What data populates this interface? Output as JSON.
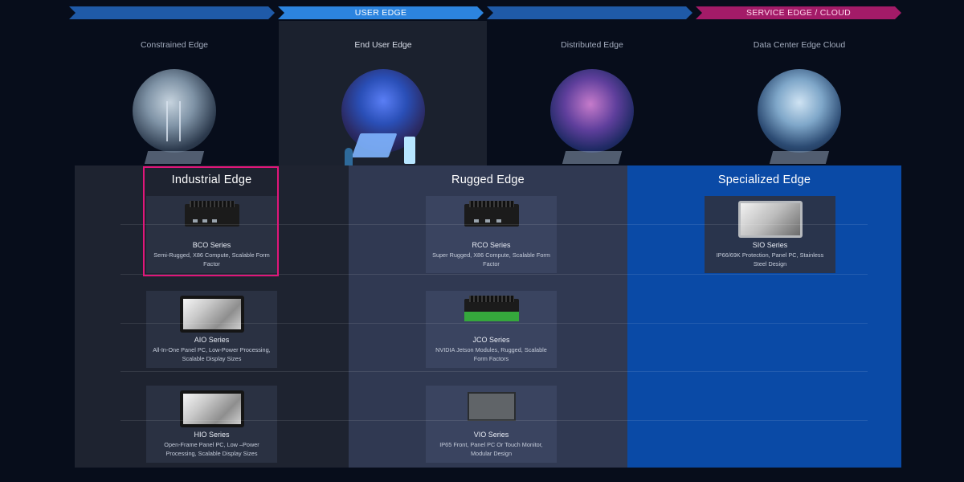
{
  "arrows": [
    "",
    "USER EDGE",
    "",
    "SERVICE EDGE / CLOUD"
  ],
  "tiers": [
    {
      "label": "Constrained Edge"
    },
    {
      "label": "End User Edge"
    },
    {
      "label": "Distributed Edge"
    },
    {
      "label": "Data Center Edge Cloud"
    }
  ],
  "categories": [
    {
      "title": "Industrial Edge"
    },
    {
      "title": "Rugged Edge"
    },
    {
      "title": "Specialized Edge"
    }
  ],
  "products": {
    "bco": {
      "name": "BCO Series",
      "desc": "Semi-Rugged, X86 Compute, Scalable Form Factor"
    },
    "aio": {
      "name": "AIO Series",
      "desc": "All-In-One Panel PC, Low-Power Processing, Scalable Display Sizes"
    },
    "hio": {
      "name": "HIO Series",
      "desc": "Open-Frame Panel PC, Low –Power Processing, Scalable Display Sizes"
    },
    "rco": {
      "name": "RCO Series",
      "desc": "Super Rugged, X86 Compute, Scalable Form Factor"
    },
    "jco": {
      "name": "JCO Series",
      "desc": "NVIDIA Jetson Modules, Rugged, Scalable Form Factors"
    },
    "vio": {
      "name": "VIO Series",
      "desc": "IP65 Front, Panel PC Or Touch Monitor, Modular Design"
    },
    "sio": {
      "name": "SIO Series",
      "desc": "IP66/69K Protection, Panel PC, Stainless Steel Design"
    }
  },
  "colors": {
    "background": "#070d1b",
    "arrow_blue": "#1f5aa8",
    "arrow_active": "#2c84df",
    "arrow_magenta": "#a31b68",
    "selection": "#e0167a",
    "specialized_panel": "#0a4aa6"
  }
}
